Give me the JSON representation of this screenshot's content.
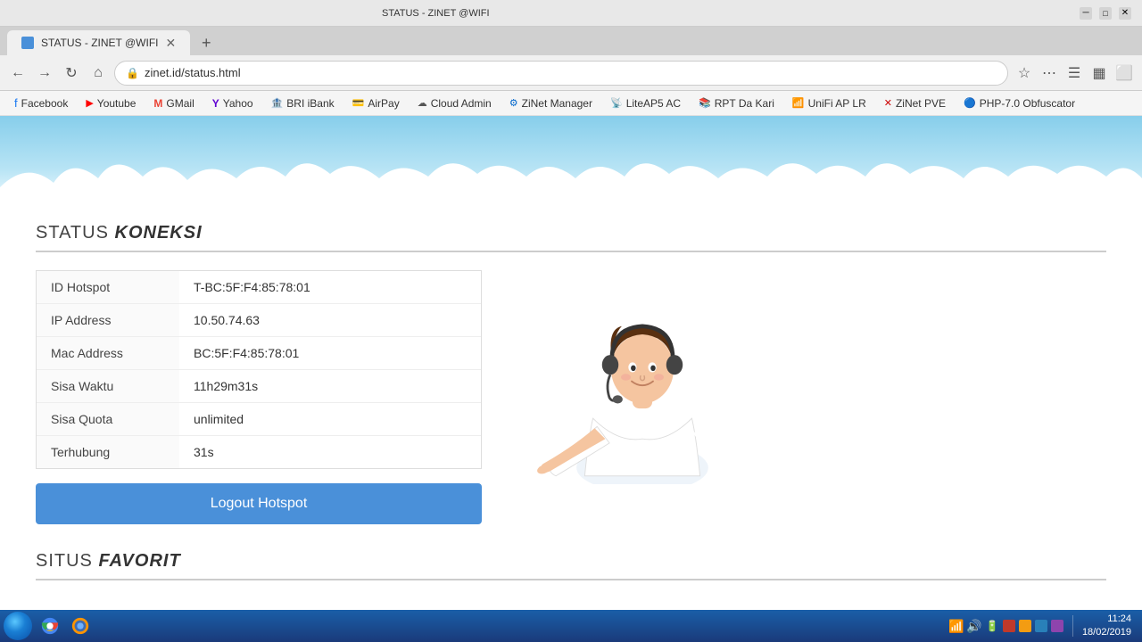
{
  "browser": {
    "tab_title": "STATUS - ZINET @WIFI",
    "tab_favicon": "blue",
    "url": "zinet.id/status.html",
    "back_btn": "←",
    "forward_btn": "→",
    "refresh_btn": "↻",
    "home_btn": "⌂"
  },
  "bookmarks": [
    {
      "label": "Facebook",
      "icon": "fb"
    },
    {
      "label": "Youtube",
      "icon": "yt"
    },
    {
      "label": "GMail",
      "icon": "gm"
    },
    {
      "label": "Yahoo",
      "icon": "ya"
    },
    {
      "label": "BRI iBank",
      "icon": "bri"
    },
    {
      "label": "AirPay",
      "icon": "ap"
    },
    {
      "label": "Cloud Admin",
      "icon": "ca"
    },
    {
      "label": "ZiNet Manager",
      "icon": "zm"
    },
    {
      "label": "LiteAP5 AC",
      "icon": "la"
    },
    {
      "label": "RPT Da Kari",
      "icon": "rp"
    },
    {
      "label": "UniFi AP LR",
      "icon": "ua"
    },
    {
      "label": "ZiNet PVE",
      "icon": "zp"
    },
    {
      "label": "PHP-7.0 Obfuscator",
      "icon": "ph"
    }
  ],
  "page": {
    "section_title_static": "STATUS",
    "section_title_italic": "KONEKSI",
    "table_rows": [
      {
        "label": "ID Hotspot",
        "value": "T-BC:5F:F4:85:78:01"
      },
      {
        "label": "IP Address",
        "value": "10.50.74.63"
      },
      {
        "label": "Mac Address",
        "value": "BC:5F:F4:85:78:01"
      },
      {
        "label": "Sisa Waktu",
        "value": "11h29m31s"
      },
      {
        "label": "Sisa Quota",
        "value": "unlimited"
      },
      {
        "label": "Terhubung",
        "value": "31s"
      }
    ],
    "logout_btn_label": "Logout Hotspot",
    "section2_title_static": "SITUS",
    "section2_title_italic": "FAVORIT"
  },
  "taskbar": {
    "clock_time": "11:24",
    "clock_date": "18/02/2019"
  }
}
